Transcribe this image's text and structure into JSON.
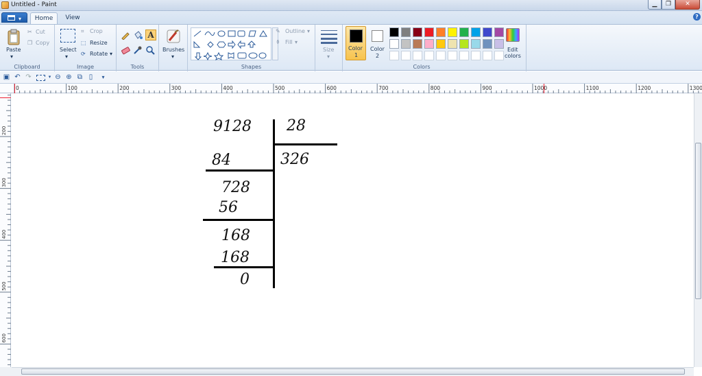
{
  "window": {
    "title": "Untitled - Paint"
  },
  "tabs": {
    "home": "Home",
    "view": "View"
  },
  "clipboard": {
    "paste": "Paste",
    "cut": "Cut",
    "copy": "Copy",
    "group": "Clipboard"
  },
  "image": {
    "select": "Select",
    "crop": "Crop",
    "resize": "Resize",
    "rotate": "Rotate",
    "group": "Image"
  },
  "tools": {
    "group": "Tools"
  },
  "brushes": {
    "label": "Brushes"
  },
  "shapes": {
    "outline": "Outline",
    "fill": "Fill",
    "group": "Shapes"
  },
  "size": {
    "label": "Size"
  },
  "colors": {
    "color1": "Color\n1",
    "color1_l1": "Color",
    "color1_l2": "1",
    "color2_l1": "Color",
    "color2_l2": "2",
    "edit_l1": "Edit",
    "edit_l2": "colors",
    "group": "Colors",
    "color1_value": "#000000",
    "color2_value": "#ffffff",
    "palette_row1": [
      "#000000",
      "#7f7f7f",
      "#880015",
      "#ed1c24",
      "#ff7f27",
      "#fff200",
      "#22b14c",
      "#00a2e8",
      "#3f48cc",
      "#a349a4"
    ],
    "palette_row2": [
      "#ffffff",
      "#c3c3c3",
      "#b97a57",
      "#ffaec9",
      "#ffc90e",
      "#efe4b0",
      "#b5e61d",
      "#99d9ea",
      "#7092be",
      "#c8bfe7"
    ],
    "palette_row3": [
      "#ffffff",
      "#ffffff",
      "#ffffff",
      "#ffffff",
      "#ffffff",
      "#ffffff",
      "#ffffff",
      "#ffffff",
      "#ffffff",
      "#ffffff"
    ]
  },
  "ruler": {
    "h_ticks": [
      "0",
      "100",
      "200",
      "300",
      "400",
      "500",
      "600",
      "700",
      "800",
      "900",
      "1000",
      "1100",
      "1200",
      "1300"
    ],
    "v_ticks": [
      "200",
      "300",
      "400",
      "500",
      "600"
    ]
  },
  "drawing": {
    "dividend": "9128",
    "divisor": "28",
    "quotient": "326",
    "step1": "84",
    "step2": "728",
    "step3": "56",
    "step4": "168",
    "step5": "168",
    "remainder": "0"
  }
}
